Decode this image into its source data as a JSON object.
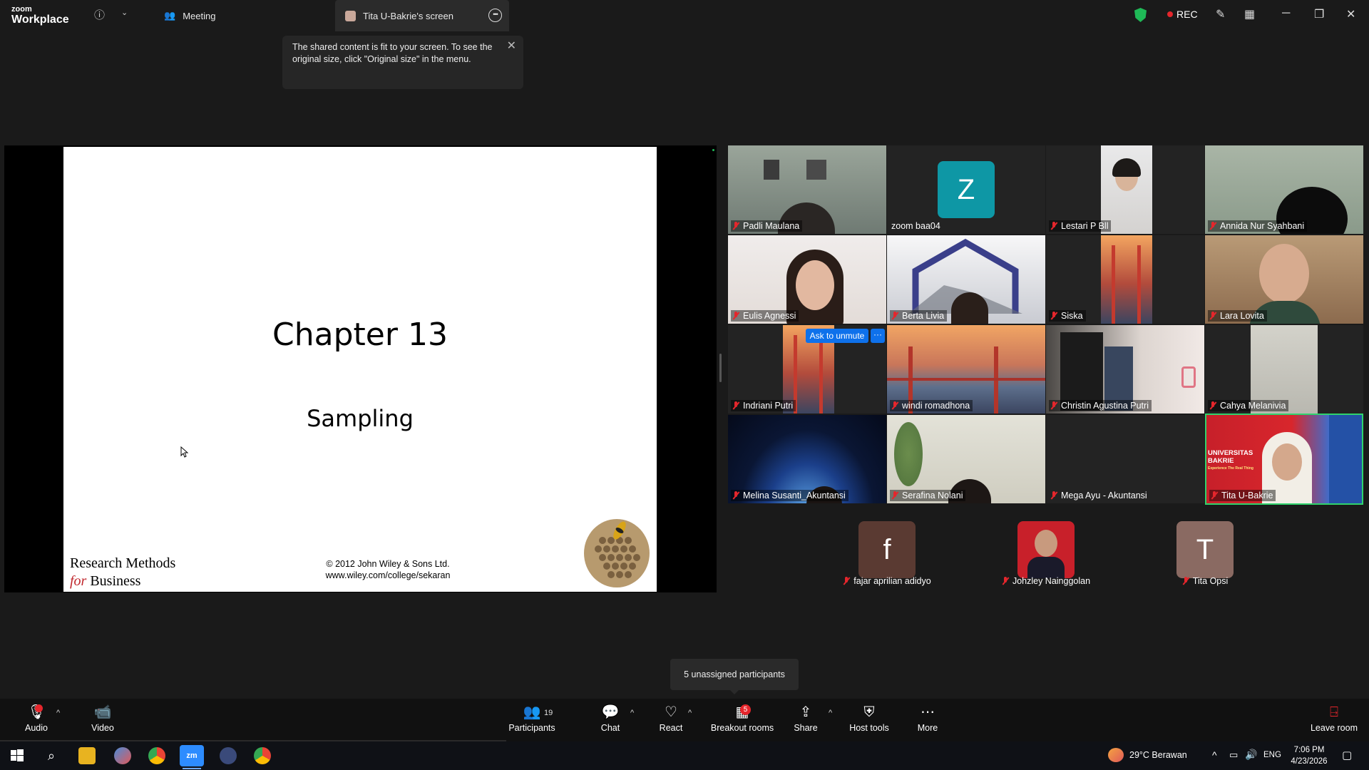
{
  "titlebar": {
    "logo_small": "zoom",
    "logo_big": "Workplace",
    "meeting_tab": "Meeting",
    "screen_tab": "Tita U-Bakrie's screen",
    "rec_label": "REC"
  },
  "notice": {
    "text": "The shared content is fit to your screen. To see the original size, click \"Original size\" in the menu."
  },
  "slide": {
    "title": "Chapter 13",
    "subtitle": "Sampling",
    "book_line1": "Research Methods",
    "book_for": "for",
    "book_line2": "Business",
    "copyright": "© 2012 John Wiley & Sons Ltd.",
    "url": "www.wiley.com/college/sekaran"
  },
  "gallery": {
    "tiles": [
      {
        "name": "Padli Maulana",
        "muted": true
      },
      {
        "name": "zoom baa04",
        "muted": false,
        "initial": "Z"
      },
      {
        "name": "Lestari P Bll",
        "muted": true
      },
      {
        "name": "Annida Nur Syahbani",
        "muted": true
      },
      {
        "name": "Eulis Agnessi",
        "muted": true
      },
      {
        "name": "Berta Livia",
        "muted": true
      },
      {
        "name": "Siska",
        "muted": true
      },
      {
        "name": "Lara Lovita",
        "muted": true
      },
      {
        "name": "Indriani Putri",
        "muted": true
      },
      {
        "name": "windi romadhona",
        "muted": true
      },
      {
        "name": "Christin Agustina Putri",
        "muted": true
      },
      {
        "name": "Cahya Melanivia",
        "muted": true
      },
      {
        "name": "Melina Susanti_Akuntansi",
        "muted": true
      },
      {
        "name": "Serafina Nolani",
        "muted": true
      },
      {
        "name": "Mega Ayu - Akuntansi",
        "muted": true
      },
      {
        "name": "Tita U-Bakrie",
        "muted": true,
        "banner_line1": "UNIVERSITAS",
        "banner_line2": "BAKRIE",
        "banner_line3": "Experience The Real Thing"
      }
    ],
    "ask_to_unmute": "Ask to unmute",
    "ask_more": "···",
    "extra": [
      {
        "name": "fajar aprilian adidyo",
        "initial": "f",
        "color": "#5a3a32"
      },
      {
        "name": "Johzley Nainggolan",
        "initial": "",
        "color": "#c8202a"
      },
      {
        "name": "Tita Opsi",
        "initial": "T",
        "color": "#8a6a62"
      }
    ]
  },
  "unassigned": "5 unassigned participants",
  "toolbar": {
    "audio": "Audio",
    "video": "Video",
    "participants": "Participants",
    "participants_count": "19",
    "chat": "Chat",
    "react": "React",
    "breakout": "Breakout rooms",
    "breakout_badge": "5",
    "share": "Share",
    "host_tools": "Host tools",
    "more": "More",
    "leave": "Leave room"
  },
  "taskbar": {
    "weather": "29°C  Berawan",
    "lang": "ENG",
    "time": "7:06 PM",
    "date": "4/23/2026"
  },
  "colors": {
    "bg": "#1a1a1a",
    "accent_blue": "#0e71eb",
    "mute_red": "#e5262c",
    "active_green": "#2fd36c",
    "zoom_avatar": "#0e97a5"
  }
}
